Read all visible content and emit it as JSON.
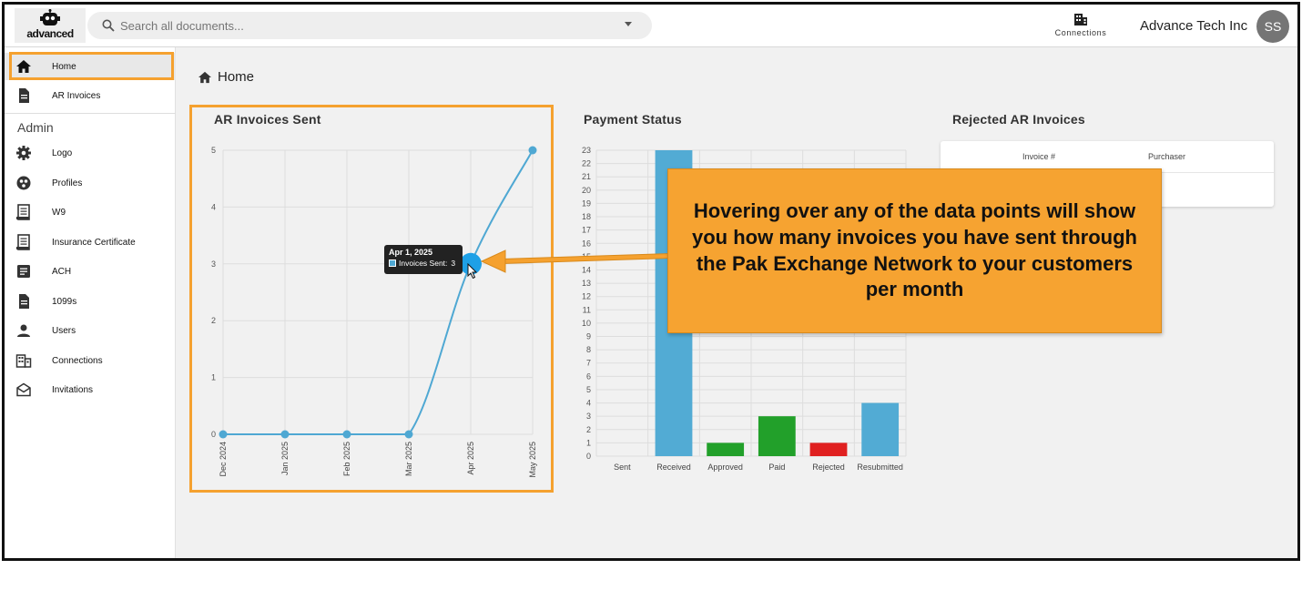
{
  "header": {
    "logo_text": "advanced",
    "search_placeholder": "Search all documents...",
    "connections_label": "Connections",
    "company_name": "Advance Tech Inc",
    "avatar_initials": "SS"
  },
  "sidebar": {
    "items": [
      {
        "label": "Home",
        "icon": "home-icon"
      },
      {
        "label": "AR Invoices",
        "icon": "document-icon"
      }
    ],
    "admin_heading": "Admin",
    "admin_items": [
      {
        "label": "Logo",
        "icon": "gear-icon"
      },
      {
        "label": "Profiles",
        "icon": "profiles-icon"
      },
      {
        "label": "W9",
        "icon": "form-icon"
      },
      {
        "label": "Insurance Certificate",
        "icon": "form-icon"
      },
      {
        "label": "ACH",
        "icon": "list-doc-icon"
      },
      {
        "label": "1099s",
        "icon": "document-icon"
      },
      {
        "label": "Users",
        "icon": "user-icon"
      },
      {
        "label": "Connections",
        "icon": "building-icon"
      },
      {
        "label": "Invitations",
        "icon": "envelope-icon"
      }
    ]
  },
  "breadcrumb": {
    "label": "Home"
  },
  "cards": {
    "ar_sent_title": "AR Invoices Sent",
    "payment_status_title": "Payment Status",
    "rejected_title": "Rejected AR Invoices"
  },
  "rejected_table": {
    "columns": [
      "Invoice #",
      "Purchaser"
    ]
  },
  "tooltip": {
    "date": "Apr 1, 2025",
    "series": "Invoices Sent:",
    "value": "3"
  },
  "callout": {
    "text": "Hovering over any of the data points will show you how many invoices you have sent through the Pak Exchange Network to your customers per month"
  },
  "colors": {
    "accent_orange": "#f5a12f",
    "line_blue": "#4fa8d3",
    "bar_blue": "#52abd4",
    "bar_green": "#22a02a",
    "bar_red": "#e02020"
  },
  "chart_data": [
    {
      "type": "line",
      "title": "AR Invoices Sent",
      "x": [
        "Dec 2024",
        "Jan 2025",
        "Feb 2025",
        "Mar 2025",
        "Apr 2025",
        "May 2025"
      ],
      "series": [
        {
          "name": "Invoices Sent",
          "values": [
            0,
            0,
            0,
            0,
            3,
            5
          ]
        }
      ],
      "ylim": [
        0,
        5
      ],
      "yticks": [
        0,
        1,
        2,
        3,
        4,
        5
      ],
      "grid": true
    },
    {
      "type": "bar",
      "title": "Payment Status",
      "categories": [
        "Sent",
        "Received",
        "Approved",
        "Paid",
        "Rejected",
        "Resubmitted"
      ],
      "values": [
        0,
        23,
        1,
        3,
        1,
        4
      ],
      "bar_colors": [
        "#52abd4",
        "#52abd4",
        "#22a02a",
        "#22a02a",
        "#e02020",
        "#52abd4"
      ],
      "ylim": [
        0,
        23
      ],
      "yticks": [
        0,
        1,
        2,
        3,
        4,
        5,
        6,
        7,
        8,
        9,
        10,
        11,
        12,
        13,
        14,
        15,
        16,
        17,
        18,
        19,
        20,
        21,
        22,
        23
      ],
      "grid": true
    }
  ]
}
